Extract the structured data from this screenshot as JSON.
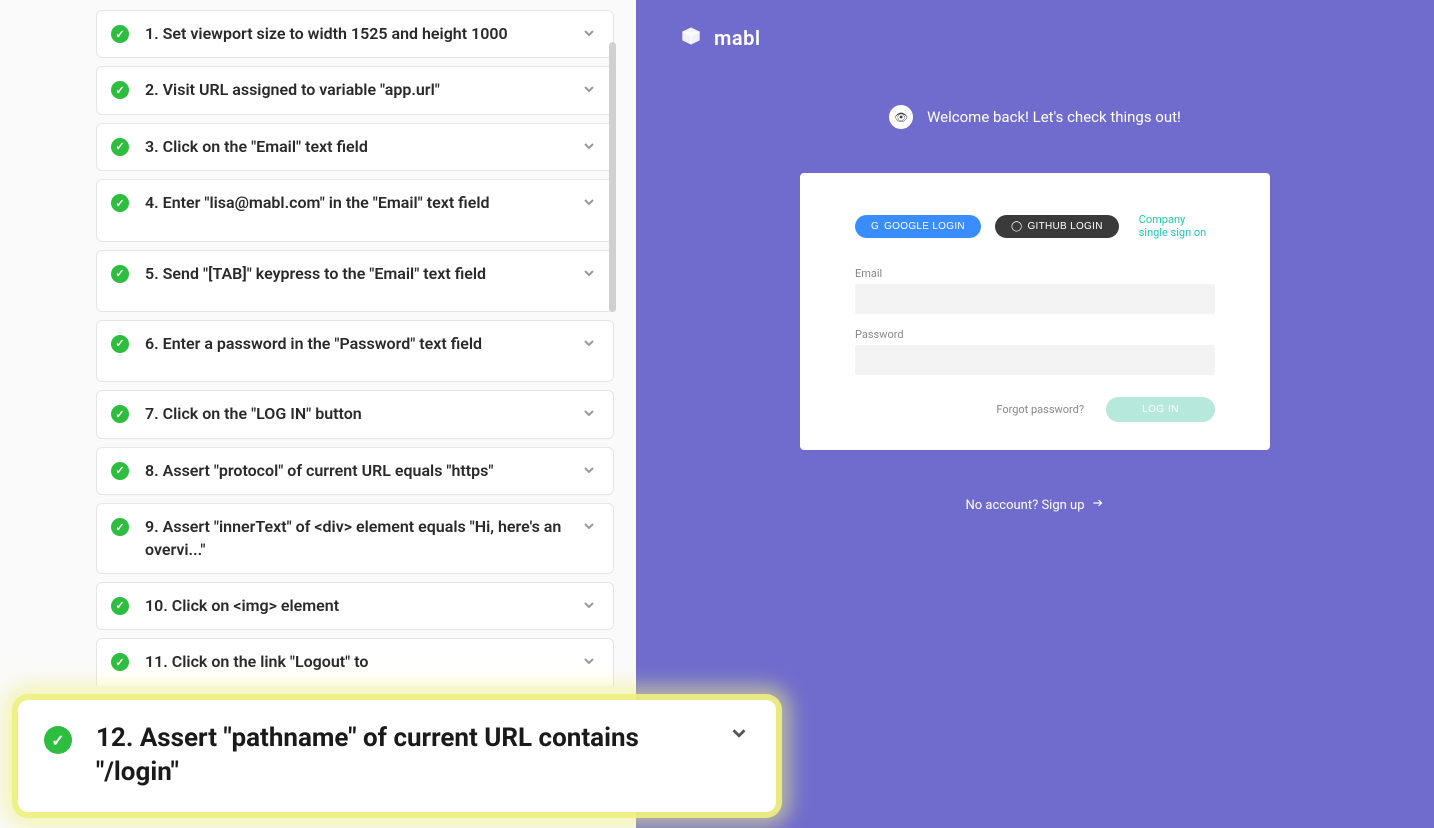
{
  "steps": [
    {
      "text": "1. Set viewport size to width 1525 and height 1000"
    },
    {
      "text": "2. Visit URL assigned to variable \"app.url\""
    },
    {
      "text": "3. Click on the \"Email\" text field"
    },
    {
      "text": "4. Enter \"lisa@mabl.com\" in the \"Email\" text field"
    },
    {
      "text": "5. Send \"[TAB]\" keypress to the \"Email\" text field"
    },
    {
      "text": "6. Enter a password in the \"Password\" text field"
    },
    {
      "text": "7. Click on the \"LOG IN\" button"
    },
    {
      "text": "8. Assert \"protocol\" of current URL equals \"https\""
    },
    {
      "text": "9. Assert \"innerText\" of <div> element equals \"Hi, here's an overvi...\""
    },
    {
      "text": "10. Click on <img> element"
    },
    {
      "text": "11. Click on the link \"Logout\" to"
    }
  ],
  "highlighted_step": {
    "text": "12. Assert \"pathname\" of current URL contains \"/login\""
  },
  "preview": {
    "brand": "mabl",
    "welcome": "Welcome back! Let's check things out!",
    "google_login": "GOOGLE LOGIN",
    "github_login": "GITHUB LOGIN",
    "sso": "Company single sign on",
    "email_label": "Email",
    "password_label": "Password",
    "forgot": "Forgot password?",
    "login_button": "LOG IN",
    "signup": "No account? Sign up"
  }
}
